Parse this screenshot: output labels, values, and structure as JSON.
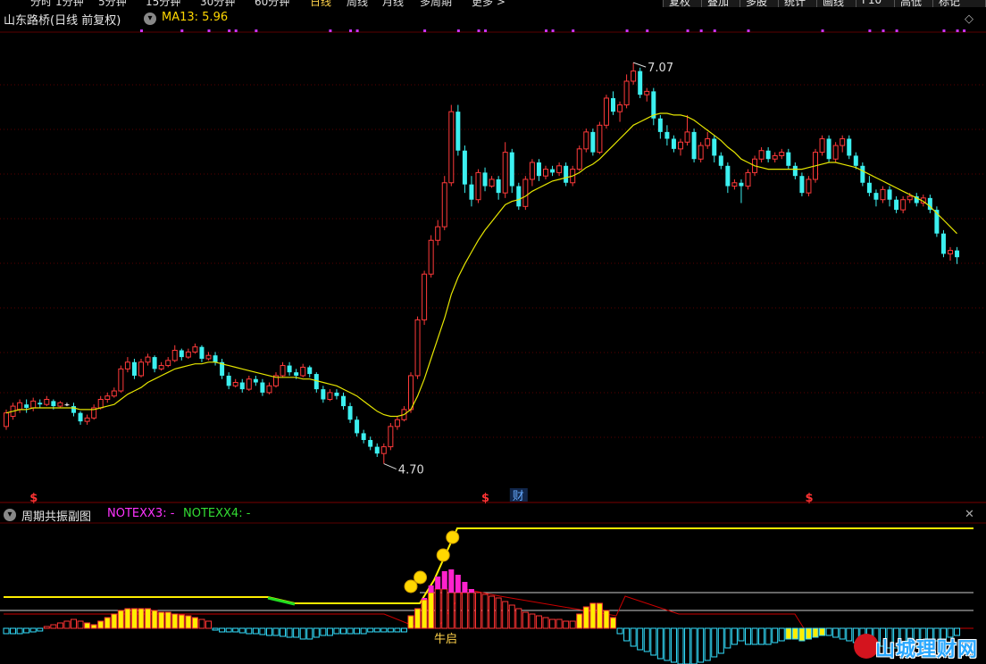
{
  "toolbar": {
    "period_tabs": [
      "分时",
      "1分钟",
      "5分钟",
      "15分钟",
      "30分钟",
      "60分钟",
      "日线",
      "周线",
      "月线",
      "多周期",
      "更多 >"
    ],
    "active_tab": "日线",
    "right_buttons": [
      "复权",
      "叠加",
      "多股",
      "统计",
      "画线",
      "F10",
      "高低",
      "标记"
    ]
  },
  "main_legend": {
    "stock_title": "山东路桥(日线 前复权)",
    "ma_text": "MA13: 5.96",
    "selector_icon": "chevron-down-icon"
  },
  "annotations": {
    "high_label": "7.07",
    "low_label": "4.70",
    "dividend_marker": "$",
    "finance_marker": "财",
    "bull_start_label": "牛启"
  },
  "sub_legend": {
    "title": "周期共振副图",
    "note3": "NOTEXX3: -",
    "note4": "NOTEXX4: -",
    "selector_icon": "chevron-down-icon"
  },
  "watermark": {
    "text": "山城理财网"
  },
  "colors": {
    "up": "#ff3a3a",
    "down": "#3cf0f0",
    "flat": "#ffffff",
    "ma": "#e6e600",
    "magenta": "#ff22cc",
    "yellow_bar": "#ffee00",
    "cyan_bar": "#33e0ff",
    "gridline": "#5a0000"
  },
  "chart_data": {
    "type": "candlestick",
    "price_range": [
      4.55,
      7.25
    ],
    "high": 7.07,
    "low": 4.7,
    "candles": [
      [
        4.92,
        5.0,
        5.02,
        4.9
      ],
      [
        4.98,
        5.04,
        5.06,
        4.96
      ],
      [
        5.02,
        5.06,
        5.08,
        5.0
      ],
      [
        5.05,
        5.03,
        5.08,
        5.0
      ],
      [
        5.03,
        5.07,
        5.09,
        5.01
      ],
      [
        5.06,
        5.05,
        5.08,
        5.03
      ],
      [
        5.05,
        5.08,
        5.1,
        5.04
      ],
      [
        5.07,
        5.04,
        5.08,
        5.02
      ],
      [
        5.04,
        5.06,
        5.07,
        5.03
      ],
      [
        5.05,
        5.05,
        5.06,
        5.04
      ],
      [
        5.04,
        5.0,
        5.06,
        4.98
      ],
      [
        5.0,
        4.95,
        5.01,
        4.93
      ],
      [
        4.95,
        4.97,
        4.99,
        4.93
      ],
      [
        4.97,
        5.03,
        5.05,
        4.96
      ],
      [
        5.03,
        5.08,
        5.1,
        5.02
      ],
      [
        5.08,
        5.1,
        5.12,
        5.06
      ],
      [
        5.1,
        5.13,
        5.15,
        5.09
      ],
      [
        5.13,
        5.26,
        5.28,
        5.12
      ],
      [
        5.26,
        5.3,
        5.33,
        5.24
      ],
      [
        5.3,
        5.22,
        5.32,
        5.2
      ],
      [
        5.22,
        5.3,
        5.32,
        5.21
      ],
      [
        5.3,
        5.33,
        5.35,
        5.28
      ],
      [
        5.33,
        5.26,
        5.34,
        5.24
      ],
      [
        5.26,
        5.28,
        5.3,
        5.25
      ],
      [
        5.28,
        5.31,
        5.33,
        5.27
      ],
      [
        5.31,
        5.37,
        5.4,
        5.3
      ],
      [
        5.37,
        5.33,
        5.38,
        5.31
      ],
      [
        5.33,
        5.36,
        5.38,
        5.32
      ],
      [
        5.36,
        5.39,
        5.41,
        5.35
      ],
      [
        5.39,
        5.32,
        5.4,
        5.3
      ],
      [
        5.32,
        5.34,
        5.36,
        5.31
      ],
      [
        5.34,
        5.3,
        5.36,
        5.28
      ],
      [
        5.3,
        5.22,
        5.32,
        5.2
      ],
      [
        5.22,
        5.16,
        5.24,
        5.14
      ],
      [
        5.16,
        5.18,
        5.2,
        5.15
      ],
      [
        5.18,
        5.14,
        5.2,
        5.12
      ],
      [
        5.14,
        5.2,
        5.22,
        5.13
      ],
      [
        5.2,
        5.18,
        5.22,
        5.16
      ],
      [
        5.18,
        5.12,
        5.2,
        5.1
      ],
      [
        5.12,
        5.16,
        5.18,
        5.11
      ],
      [
        5.16,
        5.22,
        5.24,
        5.15
      ],
      [
        5.22,
        5.28,
        5.3,
        5.21
      ],
      [
        5.28,
        5.24,
        5.3,
        5.22
      ],
      [
        5.24,
        5.22,
        5.26,
        5.2
      ],
      [
        5.22,
        5.27,
        5.29,
        5.21
      ],
      [
        5.27,
        5.23,
        5.28,
        5.21
      ],
      [
        5.23,
        5.14,
        5.24,
        5.12
      ],
      [
        5.14,
        5.08,
        5.16,
        5.06
      ],
      [
        5.08,
        5.12,
        5.14,
        5.07
      ],
      [
        5.12,
        5.1,
        5.14,
        5.08
      ],
      [
        5.1,
        5.04,
        5.12,
        5.02
      ],
      [
        5.04,
        4.96,
        5.06,
        4.94
      ],
      [
        4.96,
        4.88,
        4.98,
        4.86
      ],
      [
        4.88,
        4.84,
        4.9,
        4.82
      ],
      [
        4.84,
        4.8,
        4.86,
        4.78
      ],
      [
        4.8,
        4.76,
        4.82,
        4.74
      ],
      [
        4.76,
        4.8,
        4.82,
        4.7
      ],
      [
        4.8,
        4.92,
        4.94,
        4.78
      ],
      [
        4.92,
        4.96,
        4.98,
        4.9
      ],
      [
        4.96,
        5.02,
        5.04,
        4.95
      ],
      [
        5.02,
        5.22,
        5.24,
        5.0
      ],
      [
        5.22,
        5.55,
        5.57,
        5.2
      ],
      [
        5.55,
        5.82,
        5.84,
        5.52
      ],
      [
        5.82,
        6.02,
        6.05,
        5.8
      ],
      [
        6.02,
        6.1,
        6.14,
        5.99
      ],
      [
        6.1,
        6.36,
        6.4,
        6.08
      ],
      [
        6.36,
        6.78,
        6.82,
        6.34
      ],
      [
        6.78,
        6.55,
        6.82,
        6.52
      ],
      [
        6.55,
        6.35,
        6.58,
        6.3
      ],
      [
        6.35,
        6.26,
        6.4,
        6.22
      ],
      [
        6.26,
        6.42,
        6.44,
        6.24
      ],
      [
        6.42,
        6.34,
        6.45,
        6.31
      ],
      [
        6.34,
        6.38,
        6.4,
        6.33
      ],
      [
        6.38,
        6.3,
        6.4,
        6.26
      ],
      [
        6.3,
        6.54,
        6.6,
        6.27
      ],
      [
        6.54,
        6.34,
        6.56,
        6.3
      ],
      [
        6.34,
        6.22,
        6.36,
        6.2
      ],
      [
        6.22,
        6.38,
        6.4,
        6.2
      ],
      [
        6.38,
        6.48,
        6.5,
        6.34
      ],
      [
        6.48,
        6.4,
        6.5,
        6.37
      ],
      [
        6.4,
        6.44,
        6.46,
        6.38
      ],
      [
        6.44,
        6.42,
        6.46,
        6.4
      ],
      [
        6.42,
        6.46,
        6.48,
        6.4
      ],
      [
        6.46,
        6.36,
        6.48,
        6.34
      ],
      [
        6.36,
        6.44,
        6.46,
        6.34
      ],
      [
        6.44,
        6.56,
        6.58,
        6.43
      ],
      [
        6.56,
        6.66,
        6.68,
        6.54
      ],
      [
        6.66,
        6.54,
        6.68,
        6.52
      ],
      [
        6.54,
        6.7,
        6.72,
        6.53
      ],
      [
        6.7,
        6.86,
        6.88,
        6.68
      ],
      [
        6.86,
        6.78,
        6.9,
        6.76
      ],
      [
        6.78,
        6.82,
        6.84,
        6.72
      ],
      [
        6.82,
        6.96,
        7.0,
        6.8
      ],
      [
        6.96,
        7.02,
        7.07,
        6.94
      ],
      [
        7.02,
        6.88,
        7.04,
        6.86
      ],
      [
        6.88,
        6.9,
        6.92,
        6.84
      ],
      [
        6.9,
        6.74,
        6.92,
        6.7
      ],
      [
        6.74,
        6.66,
        6.76,
        6.62
      ],
      [
        6.66,
        6.62,
        6.7,
        6.58
      ],
      [
        6.62,
        6.56,
        6.64,
        6.54
      ],
      [
        6.56,
        6.6,
        6.62,
        6.52
      ],
      [
        6.6,
        6.66,
        6.76,
        6.58
      ],
      [
        6.66,
        6.5,
        6.68,
        6.48
      ],
      [
        6.5,
        6.58,
        6.6,
        6.48
      ],
      [
        6.58,
        6.62,
        6.66,
        6.56
      ],
      [
        6.62,
        6.52,
        6.64,
        6.48
      ],
      [
        6.52,
        6.46,
        6.54,
        6.44
      ],
      [
        6.46,
        6.34,
        6.48,
        6.3
      ],
      [
        6.34,
        6.36,
        6.38,
        6.32
      ],
      [
        6.36,
        6.34,
        6.38,
        6.24
      ],
      [
        6.34,
        6.42,
        6.44,
        6.32
      ],
      [
        6.42,
        6.5,
        6.52,
        6.4
      ],
      [
        6.5,
        6.55,
        6.57,
        6.48
      ],
      [
        6.55,
        6.5,
        6.57,
        6.48
      ],
      [
        6.5,
        6.52,
        6.54,
        6.48
      ],
      [
        6.52,
        6.54,
        6.56,
        6.5
      ],
      [
        6.54,
        6.46,
        6.56,
        6.44
      ],
      [
        6.46,
        6.4,
        6.48,
        6.38
      ],
      [
        6.4,
        6.3,
        6.42,
        6.28
      ],
      [
        6.3,
        6.38,
        6.4,
        6.28
      ],
      [
        6.38,
        6.54,
        6.56,
        6.36
      ],
      [
        6.54,
        6.62,
        6.64,
        6.52
      ],
      [
        6.62,
        6.5,
        6.64,
        6.48
      ],
      [
        6.5,
        6.58,
        6.6,
        6.48
      ],
      [
        6.58,
        6.62,
        6.64,
        6.54
      ],
      [
        6.62,
        6.52,
        6.64,
        6.5
      ],
      [
        6.52,
        6.46,
        6.54,
        6.44
      ],
      [
        6.46,
        6.36,
        6.48,
        6.34
      ],
      [
        6.36,
        6.3,
        6.4,
        6.28
      ],
      [
        6.3,
        6.26,
        6.32,
        6.22
      ],
      [
        6.26,
        6.32,
        6.34,
        6.24
      ],
      [
        6.32,
        6.26,
        6.34,
        6.22
      ],
      [
        6.26,
        6.2,
        6.28,
        6.18
      ],
      [
        6.2,
        6.26,
        6.28,
        6.18
      ],
      [
        6.26,
        6.28,
        6.3,
        6.24
      ],
      [
        6.28,
        6.24,
        6.3,
        6.22
      ],
      [
        6.24,
        6.27,
        6.29,
        6.22
      ],
      [
        6.27,
        6.2,
        6.29,
        6.18
      ],
      [
        6.2,
        6.06,
        6.22,
        6.04
      ],
      [
        6.06,
        5.94,
        6.08,
        5.92
      ],
      [
        5.94,
        5.96,
        5.98,
        5.9
      ],
      [
        5.96,
        5.92,
        5.98,
        5.88
      ]
    ],
    "ma13": [
      5.0,
      5.01,
      5.02,
      5.02,
      5.03,
      5.03,
      5.03,
      5.03,
      5.03,
      5.03,
      5.03,
      5.02,
      5.02,
      5.02,
      5.03,
      5.04,
      5.05,
      5.08,
      5.11,
      5.13,
      5.15,
      5.18,
      5.2,
      5.22,
      5.24,
      5.26,
      5.27,
      5.28,
      5.29,
      5.29,
      5.3,
      5.3,
      5.29,
      5.28,
      5.27,
      5.26,
      5.25,
      5.24,
      5.23,
      5.22,
      5.21,
      5.21,
      5.21,
      5.21,
      5.2,
      5.2,
      5.19,
      5.18,
      5.17,
      5.16,
      5.14,
      5.12,
      5.1,
      5.07,
      5.04,
      5.01,
      4.99,
      4.98,
      4.98,
      4.99,
      5.02,
      5.1,
      5.2,
      5.32,
      5.44,
      5.56,
      5.7,
      5.8,
      5.88,
      5.95,
      6.02,
      6.08,
      6.13,
      6.18,
      6.23,
      6.25,
      6.26,
      6.28,
      6.31,
      6.33,
      6.35,
      6.37,
      6.38,
      6.39,
      6.4,
      6.42,
      6.45,
      6.47,
      6.5,
      6.54,
      6.58,
      6.62,
      6.66,
      6.7,
      6.72,
      6.74,
      6.76,
      6.77,
      6.77,
      6.76,
      6.76,
      6.75,
      6.73,
      6.7,
      6.67,
      6.64,
      6.61,
      6.57,
      6.54,
      6.5,
      6.48,
      6.46,
      6.45,
      6.44,
      6.44,
      6.44,
      6.44,
      6.44,
      6.44,
      6.45,
      6.46,
      6.47,
      6.48,
      6.48,
      6.47,
      6.46,
      6.45,
      6.43,
      6.41,
      6.39,
      6.37,
      6.35,
      6.33,
      6.31,
      6.29,
      6.27,
      6.25,
      6.22,
      6.18,
      6.14,
      6.1,
      6.06
    ],
    "dividend_indices": [
      4,
      71,
      119
    ],
    "finance_index": 76,
    "purple_dot_indices": [
      20,
      26,
      30,
      33,
      34,
      37,
      48,
      51,
      52,
      62,
      67,
      70,
      71,
      80,
      81,
      84,
      92,
      95,
      101,
      103,
      105,
      110,
      121,
      128,
      130,
      132,
      139,
      141,
      142
    ],
    "sub_panel": {
      "resonance": [
        0,
        0,
        0,
        0,
        0,
        0,
        0,
        0,
        0,
        0,
        0,
        0,
        0,
        0,
        0,
        0,
        0,
        0,
        0,
        0,
        0,
        0,
        0,
        0,
        0,
        0,
        0,
        0,
        0,
        0,
        0,
        0,
        0,
        0,
        0,
        0,
        0,
        0,
        0,
        0,
        0,
        0,
        0,
        0,
        0,
        0,
        0,
        0,
        0,
        0,
        0,
        0,
        0,
        0,
        0,
        0,
        0,
        0,
        0,
        0,
        8,
        20,
        34,
        48,
        58,
        64,
        66,
        60,
        52,
        44,
        36,
        30,
        20,
        10,
        0,
        0,
        0,
        0,
        0,
        0,
        0,
        0,
        0,
        0,
        0,
        0,
        0,
        0,
        0,
        0,
        0,
        0,
        0,
        0,
        0,
        0,
        0,
        0,
        0,
        0,
        0,
        0,
        0,
        0,
        0,
        0,
        0,
        0,
        0,
        0,
        0,
        0,
        0,
        0,
        0,
        0,
        0,
        0,
        0,
        0,
        0,
        0,
        0,
        0,
        0,
        0,
        0,
        0,
        0,
        0,
        0,
        0,
        0,
        0,
        0,
        0,
        0,
        0,
        0,
        0,
        0,
        0
      ],
      "histogram": [
        -6,
        -6,
        -6,
        -5,
        -4,
        -3,
        2,
        4,
        6,
        8,
        10,
        8,
        6,
        4,
        8,
        12,
        16,
        20,
        22,
        22,
        22,
        22,
        20,
        18,
        18,
        16,
        15,
        14,
        12,
        10,
        8,
        -2,
        -4,
        -4,
        -4,
        -5,
        -6,
        -6,
        -7,
        -8,
        -8,
        -9,
        -10,
        -10,
        -12,
        -12,
        -10,
        -8,
        -8,
        -6,
        -6,
        -6,
        -6,
        -6,
        -4,
        -4,
        -4,
        -4,
        -4,
        -4,
        14,
        22,
        32,
        40,
        44,
        44,
        40,
        40,
        40,
        40,
        40,
        38,
        36,
        34,
        30,
        26,
        22,
        18,
        16,
        14,
        12,
        10,
        10,
        8,
        8,
        16,
        24,
        28,
        28,
        20,
        12,
        -6,
        -14,
        -20,
        -24,
        -26,
        -30,
        -34,
        -36,
        -38,
        -40,
        -40,
        -40,
        -38,
        -36,
        -32,
        -28,
        -22,
        -18,
        -14,
        -18,
        -18,
        -18,
        -18,
        -16,
        -14,
        -12,
        -12,
        -14,
        -12,
        -10,
        -8,
        -8,
        -10,
        -12,
        -14,
        -16,
        -16,
        -18,
        -18,
        -20,
        -22,
        -22,
        -22,
        -22,
        -20,
        -18,
        -16,
        -14,
        -12,
        -10,
        -8
      ],
      "white_level": 0.98,
      "yellow_upper_level": 1.45,
      "smiley_indices": [
        60,
        61,
        64,
        65
      ]
    }
  }
}
